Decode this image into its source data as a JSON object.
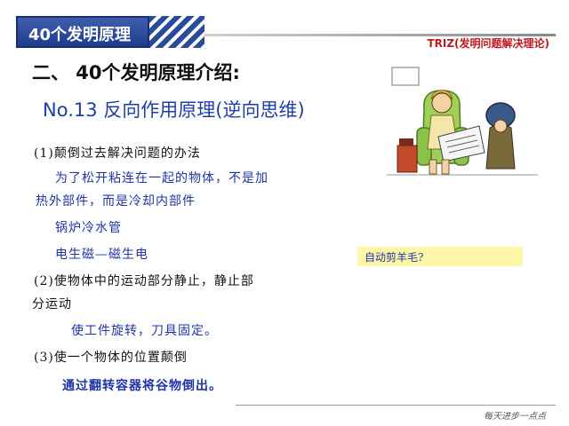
{
  "header": {
    "tab_title": "40个发明原理",
    "right_title": "TRIZ(发明问题解决理论)"
  },
  "section_title": "二、 40个发明原理介绍:",
  "principle_title": "No.13 反向作用原理(逆向思维)",
  "content": {
    "l1": "(1)颠倒过去解决问题的办法",
    "l2": "为了松开粘连在一起的物体，不是加",
    "l3": "热外部件，而是冷却内部件",
    "l4": "锅炉冷水管",
    "l5": "电生磁—磁生电",
    "l6": "(2)使物体中的运动部分静止，静止部",
    "l7": "分运动",
    "l8": "使工件旋转，刀具固定。",
    "l9": "(3)使一个物体的位置颠倒",
    "l10": "通过翻转容器将谷物倒出。"
  },
  "callout": "自动剪羊毛?",
  "watermark": "每天进步一点点",
  "colors": {
    "brand_blue": "#2a4a9c",
    "accent_red": "#c0181f",
    "callout_bg": "#fff7a8"
  }
}
